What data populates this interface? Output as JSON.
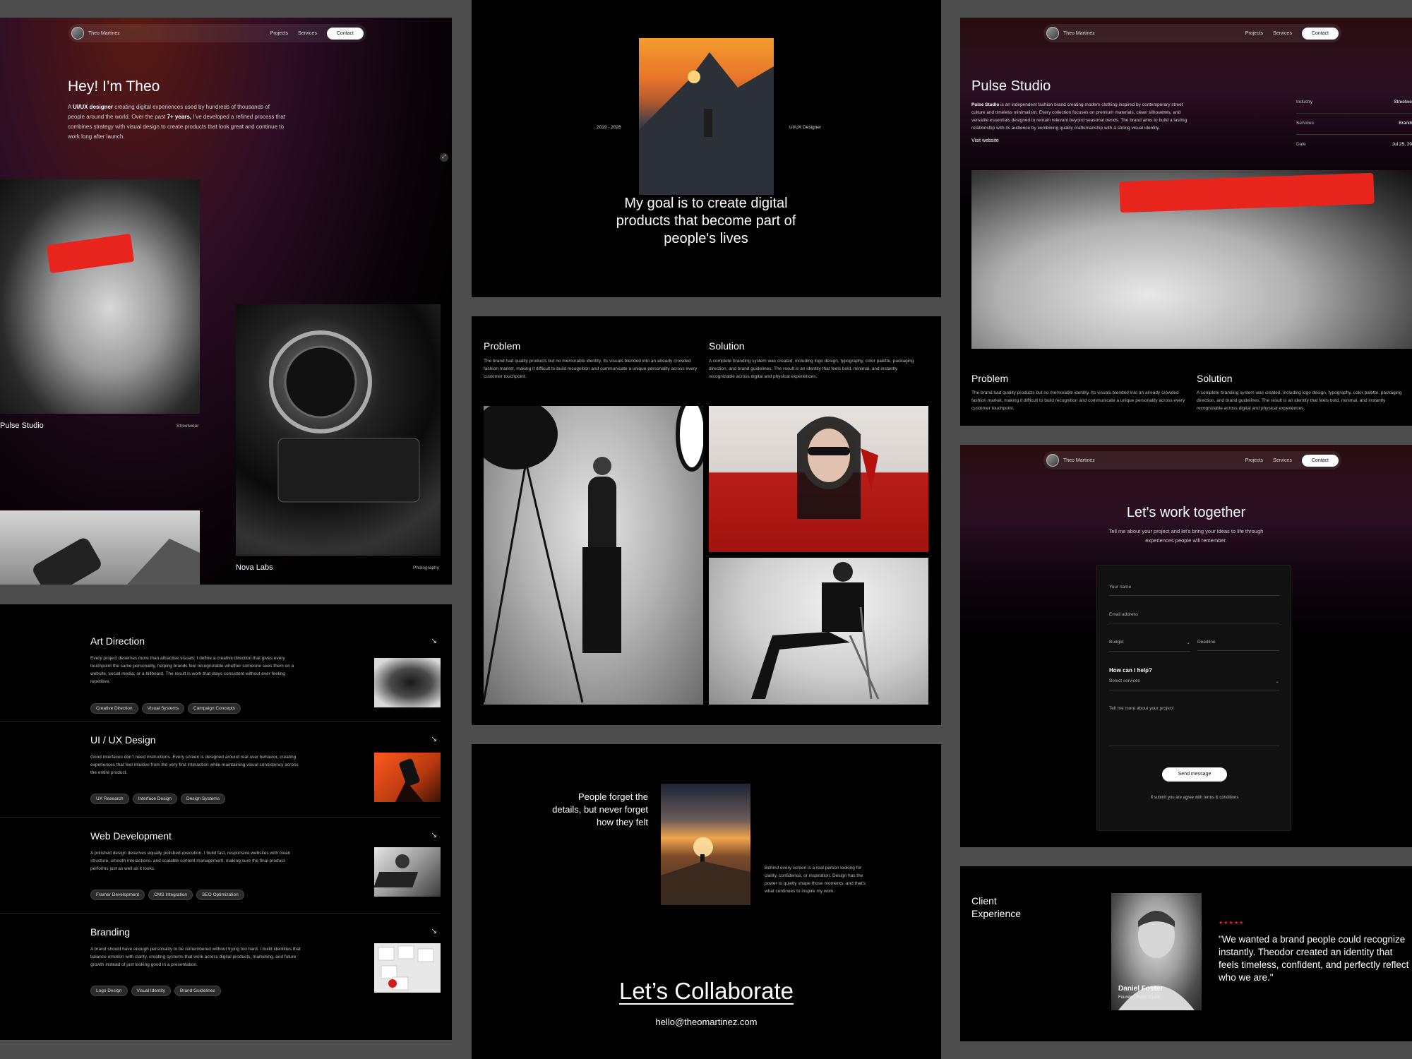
{
  "nav": {
    "brand": "Theo Martinez",
    "projects": "Projects",
    "services": "Services",
    "contact": "Contact"
  },
  "hero": {
    "title": "Hey! I’m Theo",
    "text_1": "A ",
    "text_bold_1": "UI/UX designer",
    "text_2": " creating digital experiences used by hundreds of thousands of people around the world. Over the past ",
    "text_bold_2": "7+ years,",
    "text_3": " I’ve developed a refined process that combines strategy with visual design to create products that look great and continue to work long after launch.",
    "project_1_name": "Pulse Studio",
    "project_1_tag": "Streetwear",
    "project_2_name": "Nova Labs",
    "project_2_tag": "Photography"
  },
  "about": {
    "years": "2019 - 2026",
    "role": "UI/UX Designer",
    "goal": "My goal is to create digital products that become part of people's lives"
  },
  "casestudy": {
    "title": "Pulse Studio",
    "desc_bold": "Pulse Studio",
    "desc": " is an independent fashion brand creating modern clothing inspired by contemporary street culture and timeless minimalism. Every collection focuses on premium materials, clean silhouettes, and versatile essentials designed to remain relevant beyond seasonal trends. The brand aims to build a lasting relationship with its audience by combining quality craftsmanship with a strong visual identity.",
    "visit": "Visit website",
    "meta": [
      {
        "label": "Industry",
        "value": "Streetwe"
      },
      {
        "label": "Services",
        "value": "Brandi"
      },
      {
        "label": "Date",
        "value": "Jul 25, 20"
      }
    ],
    "problem_title": "Problem",
    "problem_text": "The brand had quality products but no memorable identity. Its visuals blended into an already crowded fashion market, making it difficult to build recognition and communicate a unique personality across every customer touchpoint.",
    "solution_title": "Solution",
    "solution_text": "A complete branding system was created, including logo design, typography, color palette, packaging direction, and brand guidelines. The result is an identity that feels bold, minimal, and instantly recognizable across digital and physical experiences."
  },
  "services": [
    {
      "title": "Art Direction",
      "text": "Every project deserves more than attractive visuals. I define a creative direction that gives every touchpoint the same personality, helping brands feel recognizable whether someone sees them on a website, social media, or a billboard. The result is work that stays consistent without ever feeling repetitive.",
      "tags": [
        "Creative Direction",
        "Visual Systems",
        "Campaign Concepts"
      ]
    },
    {
      "title": "UI / UX Design",
      "text": "Good interfaces don’t need instructions. Every screen is designed around real user behavior, creating experiences that feel intuitive from the very first interaction while maintaining visual consistency across the entire product.",
      "tags": [
        "UX Research",
        "Interface Design",
        "Design Systems"
      ]
    },
    {
      "title": "Web Development",
      "text": "A polished design deserves equally polished execution. I build fast, responsive websites with clean structure, smooth interactions, and scalable content management, making sure the final product performs just as well as it looks.",
      "tags": [
        "Framer Development",
        "CMS Integration",
        "SEO Optimization"
      ]
    },
    {
      "title": "Branding",
      "text": "A brand should have enough personality to be remembered without trying too hard. I build identities that balance emotion with clarity, creating systems that work across digital products, marketing, and future growth instead of just looking good in a presentation.",
      "tags": [
        "Logo Design",
        "Visual Identity",
        "Brand Guidelines"
      ]
    }
  ],
  "quote_section": {
    "quote": "People forget the details, but never forget how they felt",
    "text": "Behind every screen is a real person looking for clarity, confidence, or inspiration. Design has the power to quietly shape those moments, and that’s what continues to inspire my work.",
    "cta": "Let’s Collaborate",
    "email": "hello@theomartinez.com"
  },
  "contact": {
    "title": "Let's work together",
    "subtitle": "Tell me about your project and let's bring your ideas to life through experiences people will remember.",
    "name_placeholder": "Your name",
    "email_placeholder": "Email address",
    "budget_placeholder": "Budget",
    "deadline_placeholder": "Deadline",
    "help_label": "How can i help?",
    "services_placeholder": "Select services",
    "message_placeholder": "Tell me more about your project",
    "send": "Send message",
    "terms": "If submit you are agree with terms & conditions"
  },
  "testimonial": {
    "heading": "Client Experience",
    "stars": "★★★★★",
    "quote": "\"We wanted a brand people could recognize instantly. Theodor created an identity that feels timeless, confident, and perfectly reflect who we are.\"",
    "name": "Daniel Foster",
    "role": "Founder, Pulse Studio"
  },
  "colors": {
    "accent_red": "#e8251c",
    "panel_bg": "#000000",
    "canvas_bg": "#4d4d4d"
  }
}
